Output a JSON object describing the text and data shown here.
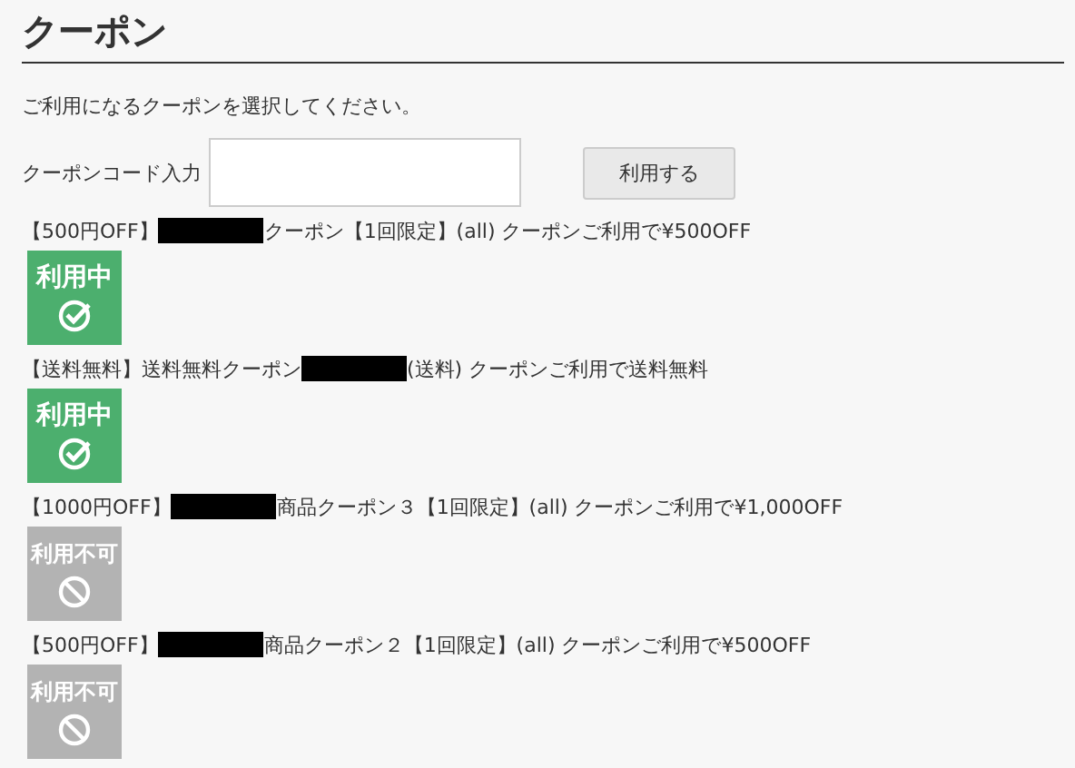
{
  "title": "クーポン",
  "instruction": "ご利用になるクーポンを選択してください。",
  "code_input": {
    "label": "クーポンコード入力",
    "button": "利用する"
  },
  "coupons": [
    {
      "prefix": "【500円OFF】",
      "suffix": "クーポン【1回限定】(all) クーポンご利用で¥500OFF",
      "status": {
        "kind": "in_use",
        "label": "利用中"
      }
    },
    {
      "prefix": "【送料無料】送料無料クーポン",
      "suffix": "(送料) クーポンご利用で送料無料",
      "status": {
        "kind": "in_use",
        "label": "利用中"
      }
    },
    {
      "prefix": "【1000円OFF】",
      "suffix": "商品クーポン３【1回限定】(all) クーポンご利用で¥1,000OFF",
      "status": {
        "kind": "unavailable",
        "label": "利用不可"
      }
    },
    {
      "prefix": "【500円OFF】",
      "suffix": "商品クーポン２【1回限定】(all) クーポンご利用で¥500OFF",
      "status": {
        "kind": "unavailable",
        "label": "利用不可"
      }
    }
  ]
}
